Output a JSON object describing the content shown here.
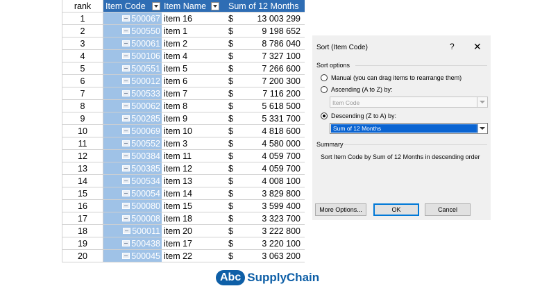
{
  "table": {
    "headers": {
      "rank": "rank",
      "code": "Item Code",
      "name": "Item Name",
      "sum": "Sum of 12 Months"
    },
    "currency_symbol": "$",
    "rows": [
      {
        "rank": "1",
        "code": "500067",
        "name": "item 16",
        "value": "13 003 299"
      },
      {
        "rank": "2",
        "code": "500550",
        "name": "item 1",
        "value": "9 198 652"
      },
      {
        "rank": "3",
        "code": "500061",
        "name": "item 2",
        "value": "8 786 040"
      },
      {
        "rank": "4",
        "code": "500106",
        "name": "item 4",
        "value": "7 327 100"
      },
      {
        "rank": "5",
        "code": "500551",
        "name": "item 5",
        "value": "7 266 600"
      },
      {
        "rank": "6",
        "code": "500012",
        "name": "item 6",
        "value": "7 200 300"
      },
      {
        "rank": "7",
        "code": "500533",
        "name": "item 7",
        "value": "7 116 200"
      },
      {
        "rank": "8",
        "code": "500062",
        "name": "item 8",
        "value": "5 618 500"
      },
      {
        "rank": "9",
        "code": "500285",
        "name": "item 9",
        "value": "5 331 700"
      },
      {
        "rank": "10",
        "code": "500069",
        "name": "item 10",
        "value": "4 818 600"
      },
      {
        "rank": "11",
        "code": "500552",
        "name": "item 3",
        "value": "4 580 000"
      },
      {
        "rank": "12",
        "code": "500384",
        "name": "item 11",
        "value": "4 059 700"
      },
      {
        "rank": "13",
        "code": "500385",
        "name": "item 12",
        "value": "4 059 700"
      },
      {
        "rank": "14",
        "code": "500534",
        "name": "item 13",
        "value": "4 008 100"
      },
      {
        "rank": "15",
        "code": "500054",
        "name": "item 14",
        "value": "3 829 800"
      },
      {
        "rank": "16",
        "code": "500080",
        "name": "item 15",
        "value": "3 599 400"
      },
      {
        "rank": "17",
        "code": "500008",
        "name": "item 18",
        "value": "3 323 700"
      },
      {
        "rank": "18",
        "code": "500011",
        "name": "item 20",
        "value": "3 222 800"
      },
      {
        "rank": "19",
        "code": "500438",
        "name": "item 17",
        "value": "3 220 100"
      },
      {
        "rank": "20",
        "code": "500045",
        "name": "item 22",
        "value": "3 063 200"
      }
    ]
  },
  "dialog": {
    "title": "Sort (Item Code)",
    "help": "?",
    "close": "✕",
    "sort_options_label": "Sort options",
    "manual_label": "Manual (you can drag items to rearrange them)",
    "ascending_label": "Ascending (A to Z) by:",
    "ascending_value": "Item Code",
    "descending_label": "Descending (Z to A) by:",
    "descending_value": "Sum of 12 Months",
    "selected_option": "descending",
    "summary_label": "Summary",
    "summary_text": "Sort Item Code by Sum of 12 Months in descending order",
    "more_options_button": "More Options...",
    "ok_button": "OK",
    "cancel_button": "Cancel"
  },
  "logo": {
    "badge": "Abc",
    "text": "SupplyChain"
  },
  "colors": {
    "header_blue": "#2e6db4",
    "code_column": "#9fc2e7",
    "selection_blue": "#0a64d2",
    "logo_blue": "#0e5fa7"
  }
}
